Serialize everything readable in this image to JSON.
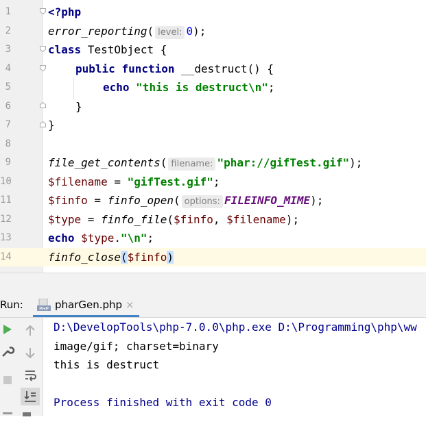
{
  "editor": {
    "lines": [
      {
        "num": "1"
      },
      {
        "num": "2"
      },
      {
        "num": "3"
      },
      {
        "num": "4"
      },
      {
        "num": "5"
      },
      {
        "num": "6"
      },
      {
        "num": "7"
      },
      {
        "num": "8"
      },
      {
        "num": "9"
      },
      {
        "num": "10"
      },
      {
        "num": "11"
      },
      {
        "num": "12"
      },
      {
        "num": "13"
      },
      {
        "num": "14"
      }
    ],
    "code": {
      "l1_tag": "<?php",
      "l2_fn": "error_reporting",
      "l2_open": "(",
      "l2_hint": "level:",
      "l2_num": "0",
      "l2_close": ");",
      "l3_kw": "class",
      "l3_rest": " TestObject {",
      "l4_kw1": "public",
      "l4_kw2": "function",
      "l4_rest": " __destruct() {",
      "l5_kw": "echo",
      "l5_str": "\"this is destruct\\n\"",
      "l5_end": ";",
      "l6": "}",
      "l7": "}",
      "l9_fn": "file_get_contents",
      "l9_open": "(",
      "l9_hint": "filename:",
      "l9_str": "\"phar://gifTest.gif\"",
      "l9_end": ");",
      "l10_var": "$filename",
      "l10_eq": " = ",
      "l10_str": "\"gifTest.gif\"",
      "l10_end": ";",
      "l11_var": "$finfo",
      "l11_eq": " = ",
      "l11_fn": "finfo_open",
      "l11_open": "(",
      "l11_hint": "options:",
      "l11_const": "FILEINFO_MIME",
      "l11_end": ");",
      "l12_var": "$type",
      "l12_eq": " = ",
      "l12_fn": "finfo_file",
      "l12_open": "(",
      "l12_arg1": "$finfo",
      "l12_comma": ", ",
      "l12_arg2": "$filename",
      "l12_end": ");",
      "l13_kw": "echo",
      "l13_var": "$type",
      "l13_dot": ".",
      "l13_str": "\"\\n\"",
      "l13_end": ";",
      "l14_fn": "finfo_close",
      "l14_open": "(",
      "l14_var": "$finfo",
      "l14_close": ")"
    }
  },
  "run": {
    "label": "Run:",
    "tab_label": "pharGen.php",
    "tab_close": "×"
  },
  "console": {
    "lines": [
      "D:\\DevelopTools\\php-7.0.0\\php.exe D:\\Programming\\php\\ww",
      "image/gif; charset=binary",
      "this is destruct",
      "",
      "Process finished with exit code 0"
    ]
  },
  "colors": {
    "keyword": "#000080",
    "string": "#008000",
    "variable": "#660000",
    "constant": "#660e7a",
    "run_green": "#4caf50",
    "console_blue": "#00008b"
  }
}
